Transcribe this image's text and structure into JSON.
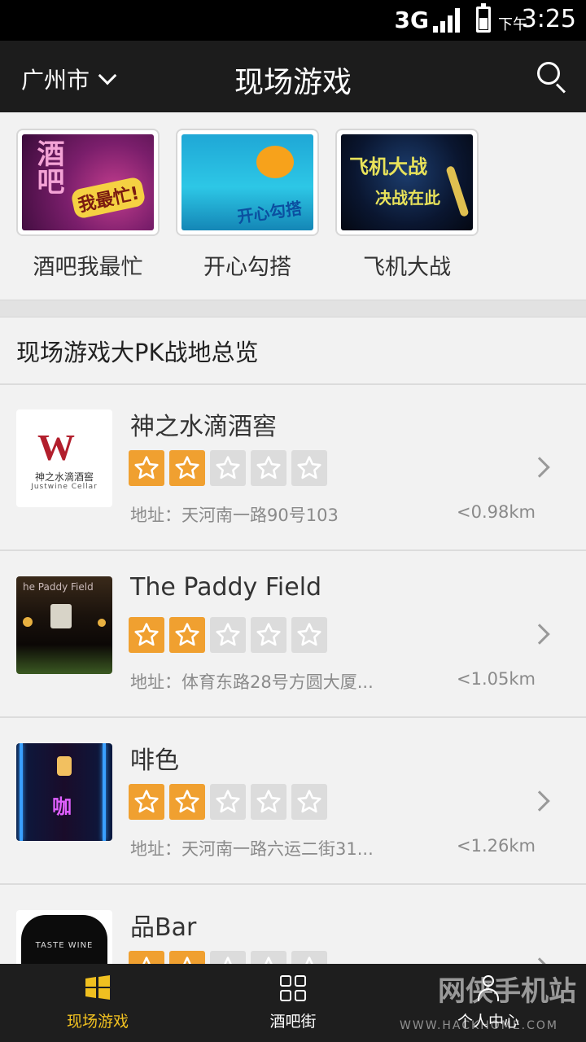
{
  "status_bar": {
    "network": "3G",
    "ampm": "下午",
    "time": "3:25"
  },
  "header": {
    "city": "广州市",
    "title": "现场游戏"
  },
  "games": [
    {
      "label": "酒吧我最忙",
      "art_text": [
        "酒吧",
        "我最忙!"
      ]
    },
    {
      "label": "开心勾搭",
      "art_text": [
        "开心勾搭"
      ]
    },
    {
      "label": "飞机大战",
      "art_text": [
        "飞机大战",
        "决战在此"
      ]
    }
  ],
  "section": {
    "title": "现场游戏大PK战地总览"
  },
  "venues": [
    {
      "name": "神之水滴酒窖",
      "rating": 2,
      "max_rating": 5,
      "address": "地址：天河南一路90号103",
      "distance": "<0.98km",
      "logo_text": "神之水滴酒窖",
      "logo_sub": "Justwine Cellar"
    },
    {
      "name": "The Paddy Field",
      "rating": 2,
      "max_rating": 5,
      "address": "地址：体育东路28号方圆大厦...",
      "distance": "<1.05km"
    },
    {
      "name": "啡色",
      "rating": 2,
      "max_rating": 5,
      "address": "地址：天河南一路六运二街31...",
      "distance": "<1.26km"
    },
    {
      "name": "品Bar",
      "rating": 2,
      "max_rating": 5,
      "logo_text": "TASTE WINE"
    }
  ],
  "tabs": [
    {
      "label": "现场游戏",
      "icon": "windows-grid-icon",
      "active": true
    },
    {
      "label": "酒吧街",
      "icon": "grid-icon",
      "active": false
    },
    {
      "label": "个人中心",
      "icon": "person-icon",
      "active": false
    }
  ],
  "watermark": {
    "text": "网侠手机站",
    "sub": "WWW.HACKHOME.COM"
  },
  "colors": {
    "accent": "#f0a030",
    "tab_active": "#f0c020",
    "header_bg": "#1c1c1c"
  }
}
